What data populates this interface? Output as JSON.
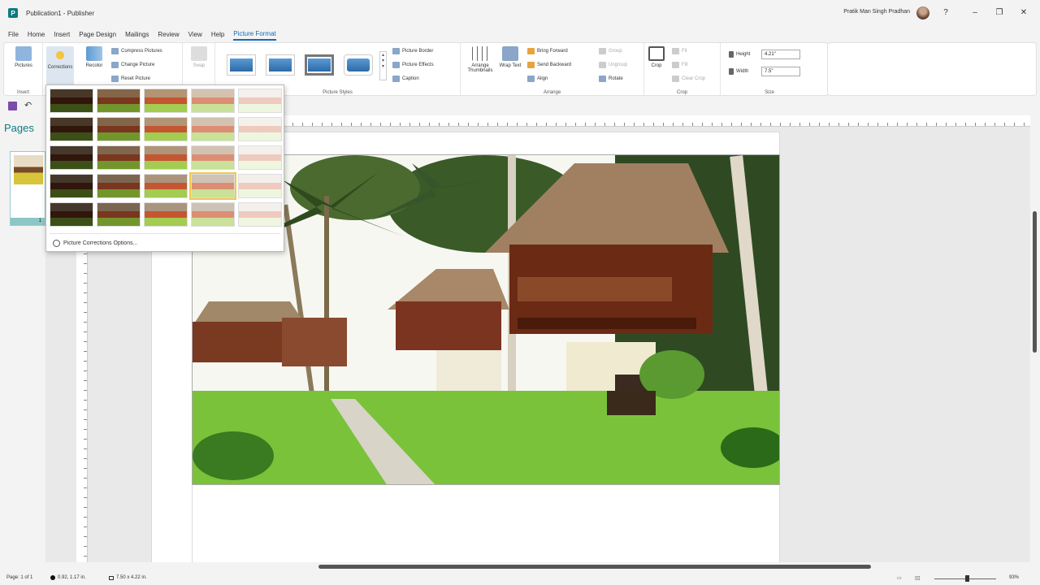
{
  "window": {
    "title": "Publication1 - Publisher",
    "user_name": "Pratik Man Singh Pradhan",
    "help_glyph": "?",
    "minimize_glyph": "–",
    "restore_glyph": "❐",
    "close_glyph": "✕"
  },
  "menu": {
    "tabs": [
      "File",
      "Home",
      "Insert",
      "Page Design",
      "Mailings",
      "Review",
      "View",
      "Help",
      "Picture Format"
    ],
    "active_tab": "Picture Format"
  },
  "ribbon": {
    "insert": {
      "pictures_label": "Pictures",
      "group_label": "Insert"
    },
    "adjust": {
      "corrections_label": "Corrections",
      "recolor_label": "Recolor",
      "compress_label": "Compress Pictures",
      "change_label": "Change Picture",
      "reset_label": "Reset Picture"
    },
    "swap": {
      "label": "Swap"
    },
    "picture_styles": {
      "group_label": "Picture Styles",
      "border": "Picture Border",
      "effects": "Picture Effects",
      "caption": "Caption"
    },
    "arrange": {
      "group_label": "Arrange",
      "arrange_thumbnails": "Arrange Thumbnails",
      "wrap_text": "Wrap Text",
      "bring_forward": "Bring Forward",
      "send_backward": "Send Backward",
      "align": "Align",
      "group": "Group",
      "ungroup": "Ungroup",
      "rotate": "Rotate"
    },
    "crop": {
      "group_label": "Crop",
      "crop_label": "Crop",
      "fit": "Fit",
      "fill": "Fill",
      "clear_crop": "Clear Crop"
    },
    "size": {
      "group_label": "Size",
      "height_label": "Height",
      "height_value": "4.21\"",
      "width_label": "Width",
      "width_value": "7.5\""
    }
  },
  "pages_panel": {
    "title": "Pages",
    "page_number": "1"
  },
  "corrections": {
    "options_label": "Picture Corrections Options...",
    "selected_index": 18
  },
  "statusbar": {
    "page": "Page: 1 of 1",
    "position": "0.92, 1.17 in.",
    "size": "7.50 x 4.22 in.",
    "zoom": "93%"
  },
  "colors": {
    "accent": "#0f6cbd",
    "brand": "#0f7b80"
  }
}
